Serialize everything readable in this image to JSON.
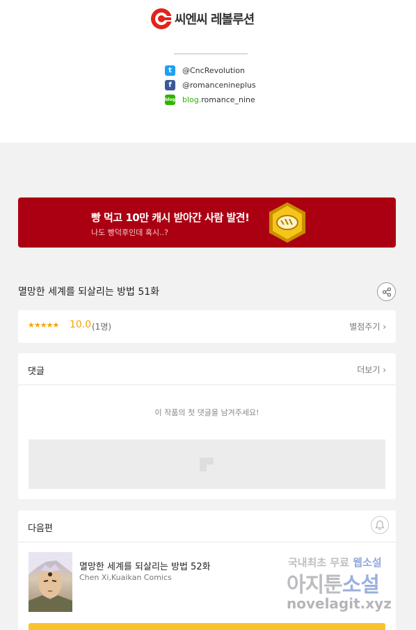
{
  "publisher": {
    "name": "씨엔씨 레볼루션",
    "social": [
      {
        "icon": "twitter-icon",
        "prefix": "",
        "handle": "@CncRevolution"
      },
      {
        "icon": "facebook-icon",
        "prefix": "",
        "handle": "@romancenineplus"
      },
      {
        "icon": "blog-icon",
        "prefix": "blog.",
        "handle": "romance_nine"
      }
    ]
  },
  "banner": {
    "title": "빵 먹고 10만 캐시 받아간 사람 발견!",
    "subtitle": "나도 빵덕후인데 혹시..?"
  },
  "episode": {
    "title": "멸망한 세계를 되살리는 방법 51화"
  },
  "rating": {
    "stars": "★★★★★",
    "score": "10.0",
    "count": "(1명)",
    "rate_link": "별점주기 ›"
  },
  "comments": {
    "heading": "댓글",
    "more": "더보기 ›",
    "empty_message": "이 작품의 첫 댓글을 남겨주세요!"
  },
  "next_episode": {
    "heading": "다음편",
    "title": "멸망한 세계를 되살리는 방법 52화",
    "authors": "Chen Xi,Kuaikan Comics"
  },
  "watermark": {
    "line1_a": "국내최초 무료 ",
    "line1_b": "웹소설",
    "line2_a": "아지툰",
    "line2_b": "소설",
    "line3": "novelagit.xyz"
  },
  "colors": {
    "banner_bg": "#ab0012",
    "star": "#f5a400",
    "next_button": "#f9c22e"
  }
}
